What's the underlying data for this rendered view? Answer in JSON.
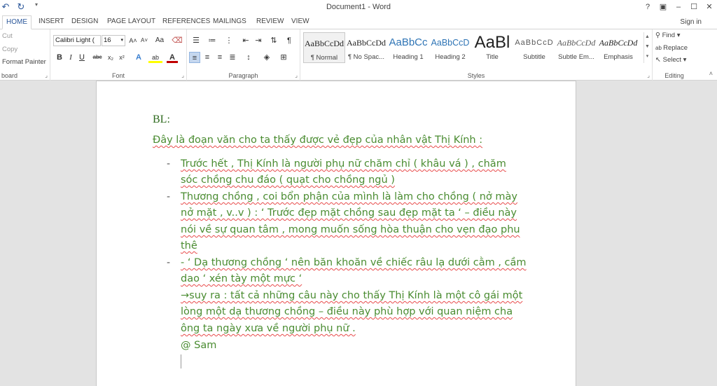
{
  "titlebar": {
    "title": "Document1 - Word",
    "undo_icon": "undo-icon",
    "redo_icon": "redo-icon",
    "customize_icon": "customize-qat-icon",
    "help_label": "?",
    "controls": [
      "ribbon-display-icon",
      "minimize-icon",
      "maximize-icon",
      "close-icon"
    ]
  },
  "tabs": [
    {
      "label": "HOME",
      "active": true
    },
    {
      "label": "INSERT"
    },
    {
      "label": "DESIGN"
    },
    {
      "label": "PAGE LAYOUT"
    },
    {
      "label": "REFERENCES"
    },
    {
      "label": "MAILINGS"
    },
    {
      "label": "REVIEW"
    },
    {
      "label": "VIEW"
    }
  ],
  "signin": "Sign in",
  "clipboard": {
    "cut": "Cut",
    "copy": "Copy",
    "format_painter": "Format Painter",
    "label": "board"
  },
  "font": {
    "name": "Calibri Light (",
    "size": "16",
    "label": "Font",
    "bold": "B",
    "italic": "I",
    "underline": "U",
    "strike": "abc",
    "subscript": "x₂",
    "superscript": "x²",
    "grow": "A˄",
    "shrink": "A˅",
    "case": "Aa",
    "effects": "A",
    "highlight": "ab",
    "color": "A"
  },
  "paragraph": {
    "label": "Paragraph",
    "pilcrow": "¶"
  },
  "styles": {
    "label": "Styles",
    "items": [
      {
        "preview": "AaBbCcDd",
        "name": "¶ Normal"
      },
      {
        "preview": "AaBbCcDd",
        "name": "¶ No Spac..."
      },
      {
        "preview": "AaBbCc",
        "name": "Heading 1"
      },
      {
        "preview": "AaBbCcD",
        "name": "Heading 2"
      },
      {
        "preview": "AaBl",
        "name": "Title"
      },
      {
        "preview": "AaBbCcD",
        "name": "Subtitle"
      },
      {
        "preview": "AaBbCcDd",
        "name": "Subtle Em..."
      },
      {
        "preview": "AaBbCcDd",
        "name": "Emphasis"
      }
    ]
  },
  "editing": {
    "label": "Editing",
    "find": "Find",
    "replace": "Replace",
    "select": "Select"
  },
  "document": {
    "heading": "BL:",
    "intro": "Đây là đoạn văn cho ta thấy được vẻ đẹp của nhân vật Thị Kính :",
    "bullet1_line1": "Trước hết , Thị Kính là người phụ nữ chăm chỉ ( khâu vá ) , chăm",
    "bullet1_line2": "sóc chồng chu đáo ( quạt cho chồng ngủ )",
    "bullet2_line1": "Thương chồng , coi bổn phận của mình là làm cho chồng ( nở mày",
    "bullet2_line2": "nở mặt , v..v ) : ‘ Trước đẹp mặt chồng sau đẹp mặt ta ‘ – điều này",
    "bullet2_line3": "nói về sự quan tâm , mong muốn sống hòa thuận cho vẹn đạo phu",
    "bullet2_line4": "thê",
    "bullet3_line1": "- ‘ Dạ thương chồng ‘ nên băn khoăn về chiếc râu lạ dưới cằm , cầm",
    "bullet3_line2": "dao ‘ xén tày một mực ‘",
    "conclusion_line1": "→suy ra : tất cả những câu này cho thấy Thị Kính là một cô gái một",
    "conclusion_line2": "lòng một dạ thương chồng – điều này phù hợp với quan niệm cha",
    "conclusion_line3": "ông ta ngày xưa về người phụ nữ .",
    "signature": "@ Sam",
    "bullet_marker": "-"
  },
  "colors": {
    "accent": "#2b579a",
    "text_green": "#4a8c31",
    "heading_green": "#2f6b1f",
    "spell_red": "#e84b4b"
  }
}
